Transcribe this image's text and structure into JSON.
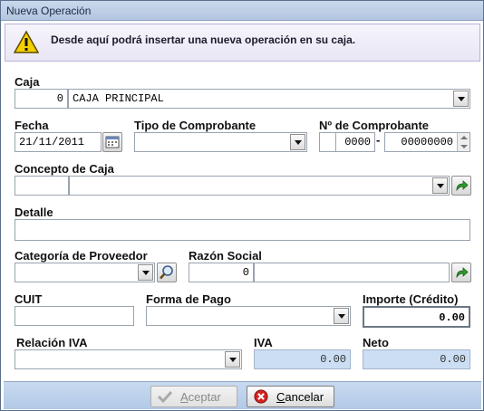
{
  "window": {
    "title": "Nueva Operación"
  },
  "banner": {
    "icon": "warning-icon",
    "message": "Desde aquí podrá insertar una nueva operación en su caja."
  },
  "caja": {
    "label": "Caja",
    "code": "0",
    "name": "CAJA PRINCIPAL"
  },
  "fecha": {
    "label": "Fecha",
    "value": "21/11/2011"
  },
  "tipo_comprobante": {
    "label": "Tipo de Comprobante",
    "value": ""
  },
  "nro_comprobante": {
    "label": "Nº de Comprobante",
    "letter": "",
    "prefix": "0000",
    "separator": "-",
    "number": "00000000"
  },
  "concepto": {
    "label": "Concepto de Caja",
    "code": "",
    "value": ""
  },
  "detalle": {
    "label": "Detalle",
    "value": ""
  },
  "categoria_proveedor": {
    "label": "Categoría de Proveedor",
    "value": ""
  },
  "razon_social": {
    "label": "Razón Social",
    "code": "0",
    "name": ""
  },
  "cuit": {
    "label": "CUIT",
    "value": ""
  },
  "forma_pago": {
    "label": "Forma de Pago",
    "value": ""
  },
  "importe": {
    "label": "Importe (Crédito)",
    "value": "0.00"
  },
  "relacion_iva": {
    "label": "Relación IVA",
    "value": ""
  },
  "iva": {
    "label": "IVA",
    "value": "0.00"
  },
  "neto": {
    "label": "Neto",
    "value": "0.00"
  },
  "buttons": {
    "accept": {
      "label_first": "A",
      "label_rest": "ceptar",
      "enabled": false
    },
    "cancel": {
      "label_first": "C",
      "label_rest": "ancelar",
      "enabled": true
    }
  }
}
